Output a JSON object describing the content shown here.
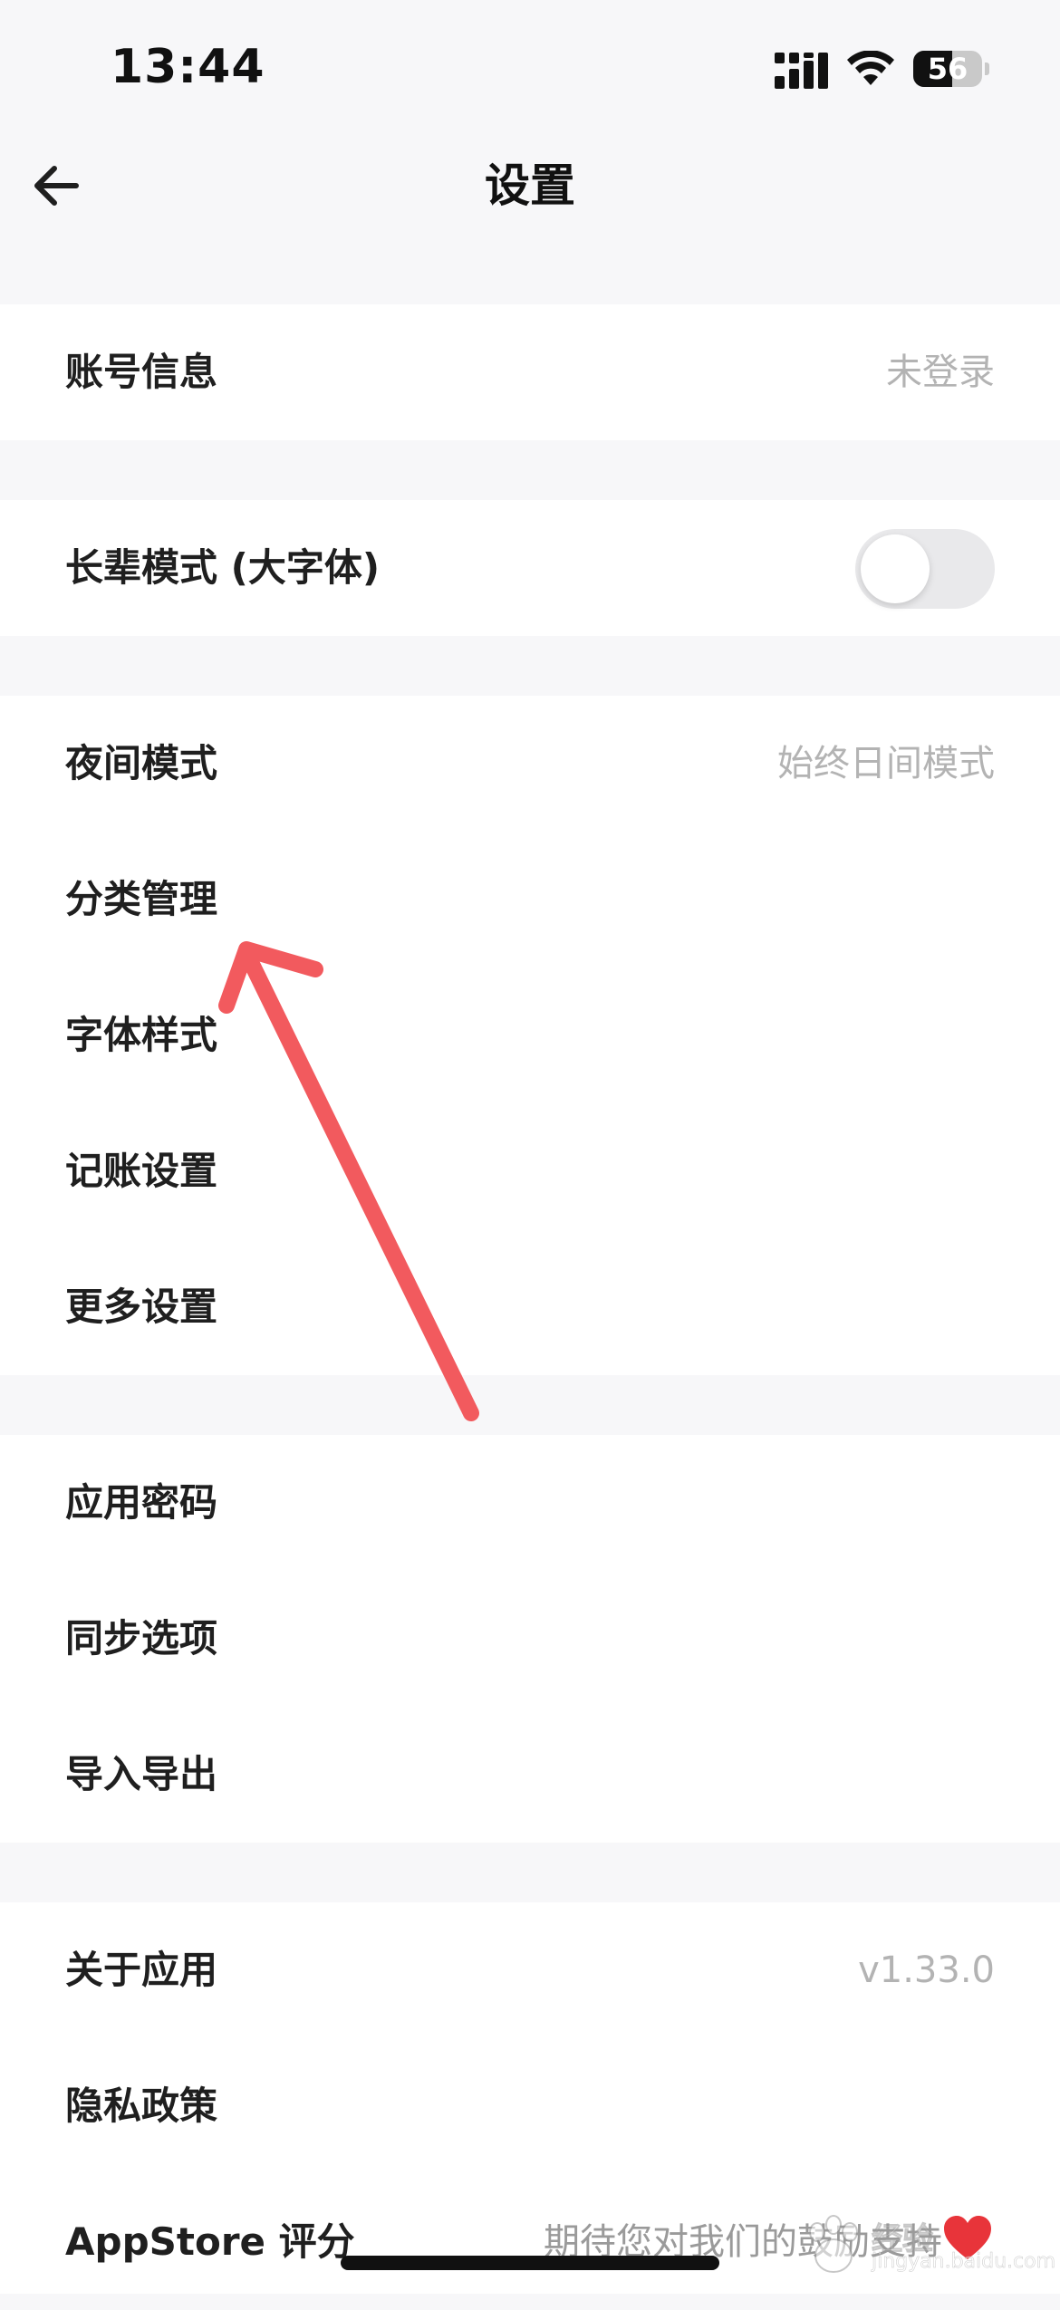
{
  "status_bar": {
    "time": "13:44",
    "battery_text": "56",
    "battery_level": 0.56
  },
  "nav": {
    "title": "设置",
    "back_icon": "arrow-left-icon"
  },
  "groups": [
    {
      "rows": [
        {
          "label": "账号信息",
          "value": "未登录"
        }
      ]
    },
    {
      "rows": [
        {
          "label": "长辈模式 (大字体)",
          "toggle_on": false
        }
      ]
    },
    {
      "rows": [
        {
          "label": "夜间模式",
          "value": "始终日间模式"
        },
        {
          "label": "分类管理"
        },
        {
          "label": "字体样式"
        },
        {
          "label": "记账设置"
        },
        {
          "label": "更多设置"
        }
      ]
    },
    {
      "rows": [
        {
          "label": "应用密码"
        },
        {
          "label": "同步选项"
        },
        {
          "label": "导入导出"
        }
      ]
    },
    {
      "rows": [
        {
          "label": "关于应用",
          "value": "v1.33.0"
        },
        {
          "label": "隐私政策"
        },
        {
          "label": "AppStore 评分",
          "value": "期待您对我们的鼓励支持",
          "icon": "heart-icon"
        }
      ]
    }
  ],
  "annotation": {
    "color": "#f25a5e"
  },
  "watermark": {
    "text": "经验",
    "sub": "jingyan.baidu.com"
  },
  "colors": {
    "background": "#f7f7f9",
    "card": "#ffffff",
    "secondary_text": "#b3b3b3",
    "heart": "#e8343a"
  }
}
